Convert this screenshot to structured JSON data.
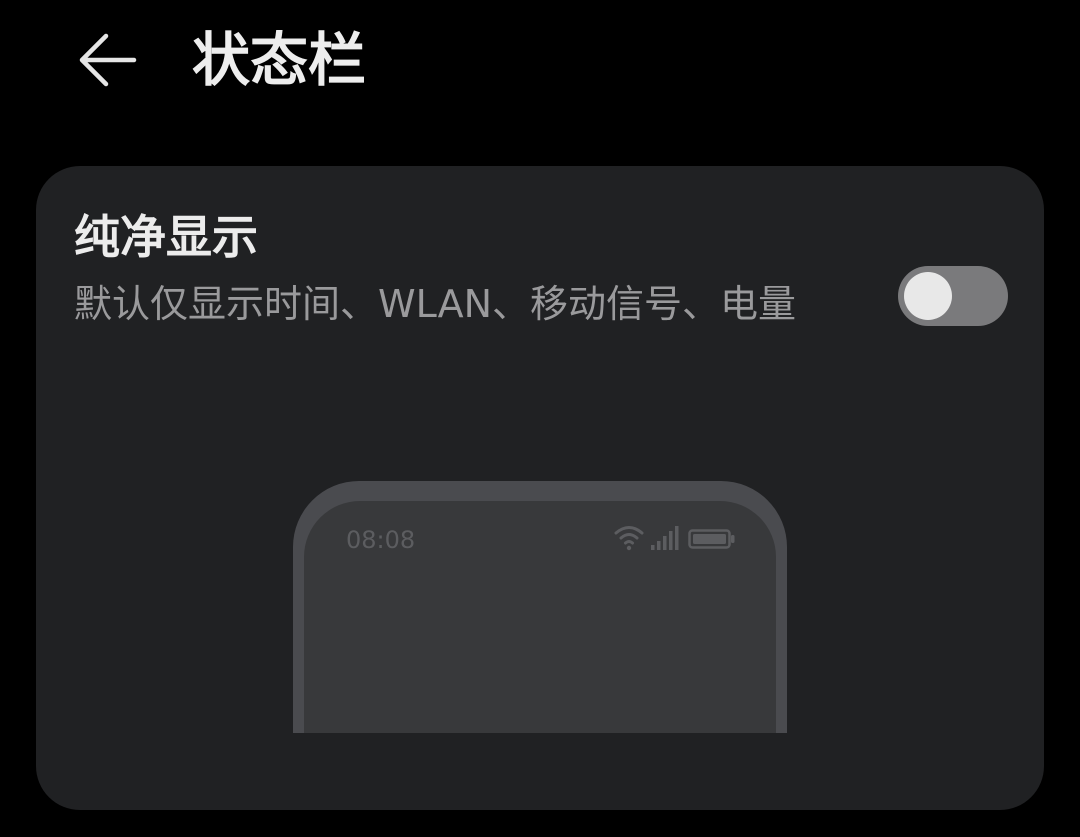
{
  "header": {
    "back_icon": "back-arrow-icon",
    "title": "状态栏"
  },
  "setting": {
    "title": "纯净显示",
    "description": "默认仅显示时间、WLAN、移动信号、电量",
    "toggle_on": false
  },
  "preview": {
    "time": "08:08",
    "icons": [
      "wifi-icon",
      "signal-icon",
      "battery-icon"
    ]
  },
  "colors": {
    "background": "#000000",
    "card": "#202123",
    "toggle_track": "#7a7a7c",
    "toggle_knob": "#e8e8e8",
    "phone_frame": "#4a4b4f",
    "phone_screen": "#38393b"
  }
}
